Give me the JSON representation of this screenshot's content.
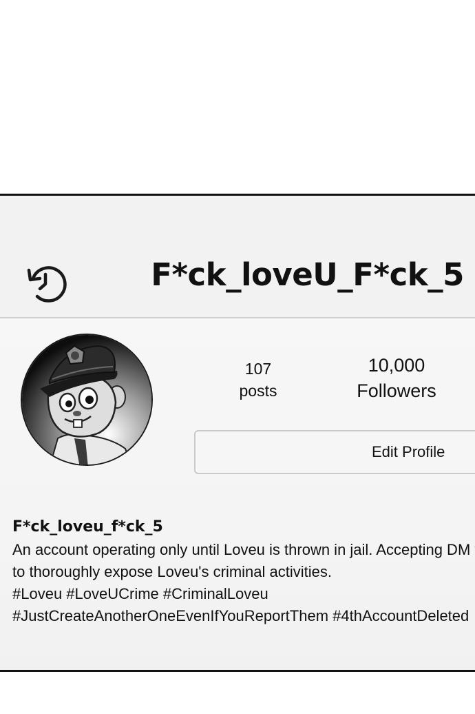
{
  "header": {
    "icon": "history-icon",
    "username": "F*ck_loveU_F*ck_5"
  },
  "profile": {
    "avatar_icon": "avatar",
    "stats": {
      "posts_count": "107",
      "posts_label": "posts",
      "followers_count": "10,000",
      "followers_label": "Followers"
    },
    "edit_button_label": "Edit Profile"
  },
  "bio": {
    "name": "F*ck_loveu_f*ck_5",
    "lines": [
      "An account operating only until Loveu is thrown in jail. Accepting DM tips",
      "to thoroughly expose Loveu's criminal activities.",
      "#Loveu #LoveUCrime #CriminalLoveu",
      "#JustCreateAnotherOneEvenIfYouReportThem #4thAccountDeleted"
    ]
  },
  "colors": {
    "panel_border": "#111111",
    "header_bg": "#f2f2f2",
    "divider": "#cfcfcf",
    "button_border": "#c9c9c9"
  }
}
